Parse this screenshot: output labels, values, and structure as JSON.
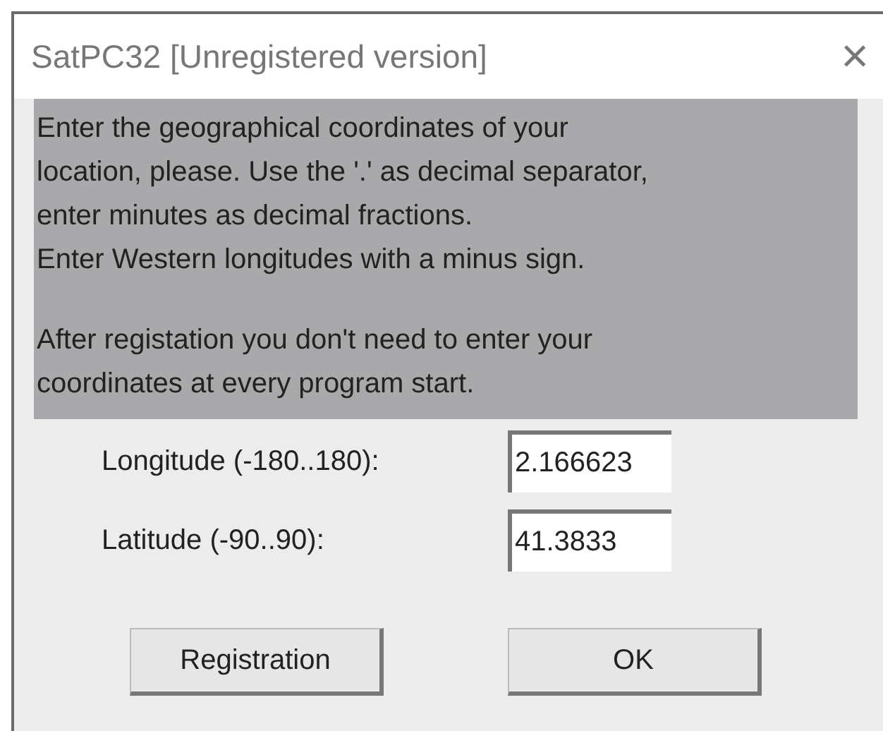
{
  "window": {
    "title": "SatPC32 [Unregistered version]",
    "close": "×"
  },
  "message": [
    [
      "Enter the geographical coordinates of your",
      "location, please. Use the '.' as decimal separator,",
      "enter minutes as decimal fractions.",
      "Enter Western longitudes with a minus sign."
    ],
    [
      "After registation you don't need to enter your",
      "coordinates at every program start."
    ]
  ],
  "fields": [
    {
      "label": "Longitude (-180..180):",
      "value": "2.166623"
    },
    {
      "label": "Latitude (-90..90):",
      "value": "41.3833"
    }
  ],
  "buttons": [
    "Registration",
    "OK"
  ]
}
